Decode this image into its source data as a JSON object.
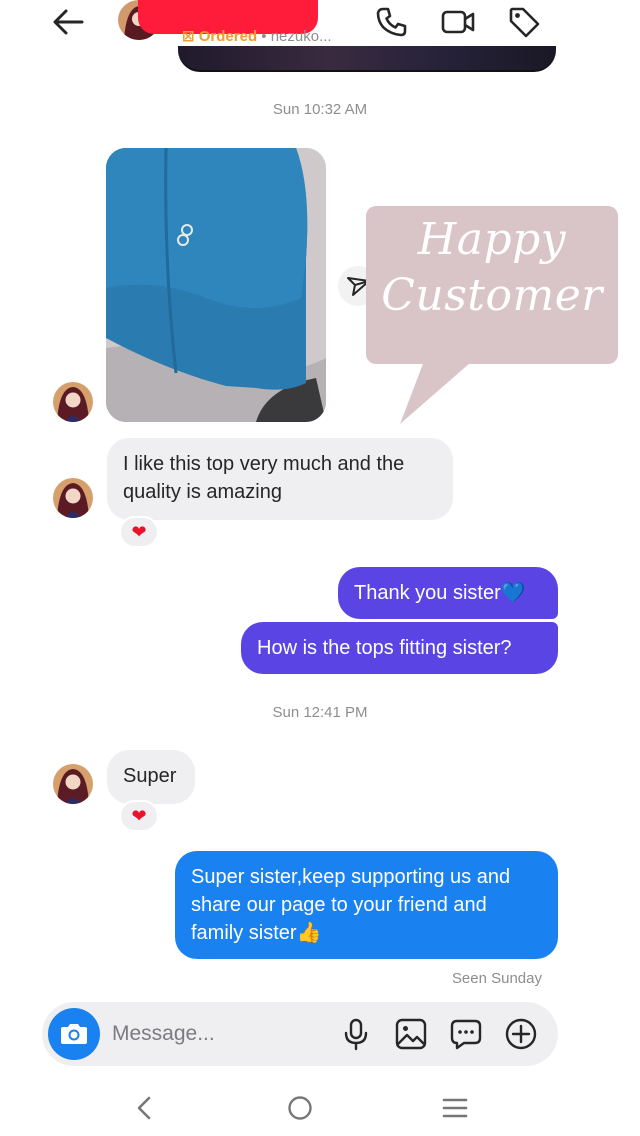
{
  "header": {
    "status_label": "Ordered",
    "username_partial": "• nezuko..."
  },
  "messages": {
    "timestamp_1": "Sun 10:32 AM",
    "sticker_line_1": "Happy",
    "sticker_line_2": "Customer",
    "incoming_1": "I like this top very much and the quality is amazing",
    "reaction_1": "❤",
    "outgoing_1": "Thank you sister💙",
    "outgoing_2": "How is the tops fitting sister?",
    "timestamp_2": "Sun 12:41 PM",
    "incoming_2": "Super",
    "reaction_2": "❤",
    "outgoing_3": "Super sister,keep supporting us and share our page to your friend and family sister👍",
    "seen_status": "Seen Sunday"
  },
  "composer": {
    "placeholder": "Message..."
  },
  "colors": {
    "outgoing_purple": "#5a44e3",
    "outgoing_blue": "#1a82f0",
    "incoming_bg": "#efeff2",
    "accent_orange": "#f59b2a",
    "redaction": "#ff1c3a",
    "sticker_bg": "#d9c4c7"
  },
  "icons": {
    "back": "arrow-left-icon",
    "call": "phone-icon",
    "video": "video-camera-icon",
    "tag": "tag-icon",
    "share": "paper-plane-icon",
    "camera": "camera-icon",
    "mic": "microphone-icon",
    "gallery": "image-icon",
    "sticker": "chat-bubble-icon",
    "more": "plus-circle-icon",
    "nav_back": "chevron-left-icon",
    "nav_home": "circle-home-icon",
    "nav_menu": "menu-lines-icon"
  }
}
